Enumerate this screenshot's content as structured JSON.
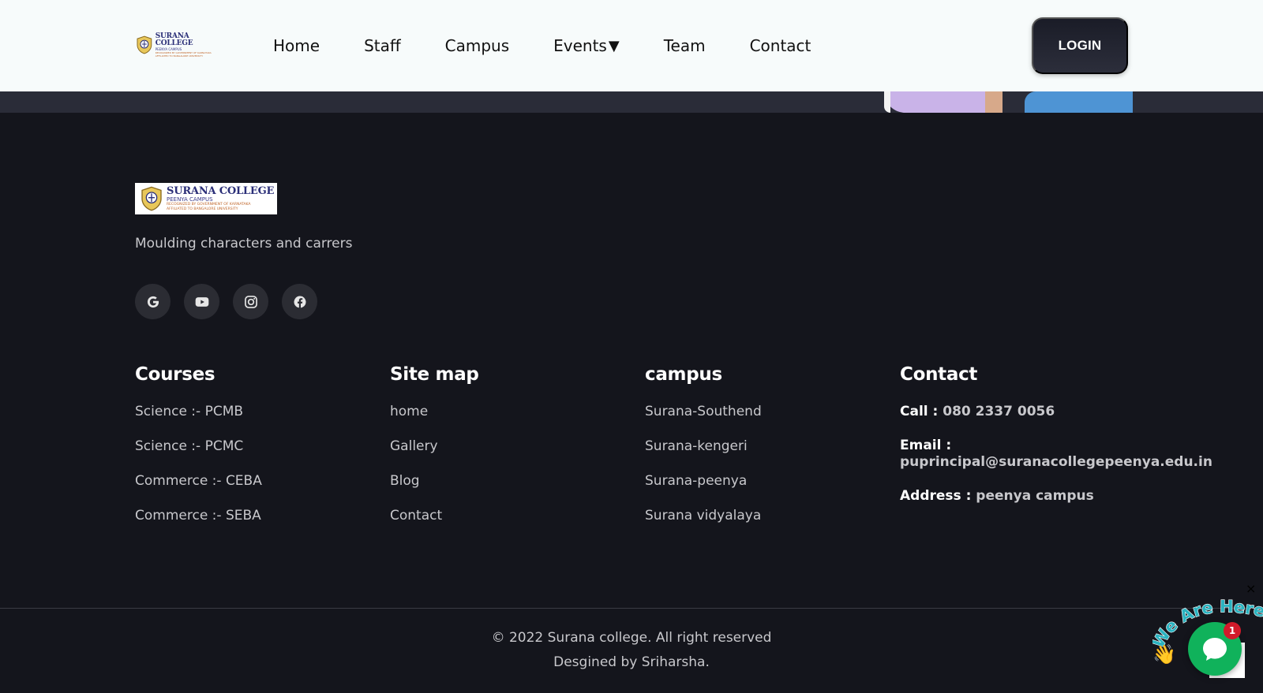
{
  "header": {
    "logo": {
      "title": "SURANA COLLEGE",
      "subtitle": "PEENYA CAMPUS",
      "line3": "RECOGNIZED BY GOVERNMENT OF KARNATAKA",
      "line4": "AFFILIATED TO BANGALORE UNIVERSITY"
    },
    "nav": [
      {
        "label": "Home"
      },
      {
        "label": "Staff"
      },
      {
        "label": "Campus"
      },
      {
        "label": "Events",
        "caret": "▼"
      },
      {
        "label": "Team"
      },
      {
        "label": "Contact"
      }
    ],
    "login_label": "LOGIN"
  },
  "footer": {
    "logo": {
      "title": "SURANA COLLEGE",
      "subtitle": "PEENYA CAMPUS",
      "line3": "RECOGNIZED BY GOVERNMENT OF KARNATAKA",
      "line4": "AFFILIATED TO BANGALORE UNIVERSITY"
    },
    "tagline": "Moulding characters and carrers",
    "socials": [
      "google-icon",
      "youtube-icon",
      "instagram-icon",
      "facebook-icon"
    ],
    "courses": {
      "heading": "Courses",
      "items": [
        "Science :- PCMB",
        "Science :- PCMC",
        "Commerce :- CEBA",
        "Commerce :- SEBA"
      ]
    },
    "sitemap": {
      "heading": "Site map",
      "items": [
        "home",
        "Gallery",
        "Blog",
        "Contact"
      ]
    },
    "campus": {
      "heading": "campus",
      "items": [
        "Surana-Southend",
        "Surana-kengeri",
        "Surana-peenya",
        "Surana vidyalaya"
      ]
    },
    "contact": {
      "heading": "Contact",
      "call_label": "Call :",
      "call_value": "080 2337 0056",
      "email_label": "Email :",
      "email_value": "puprincipal@suranacollegepeenya.edu.in",
      "address_label": "Address :",
      "address_value": "peenya campus"
    },
    "copyright": "© 2022 Surana college. All right reserved",
    "designed_by": "Desgined by Sriharsha."
  },
  "chat_widget": {
    "banner": "We Are Here!",
    "badge_count": "1",
    "close_symbol": "×",
    "hand": "👋",
    "colors": {
      "bubble": "#10b25b",
      "badge": "#d11a2a",
      "banner_text": "#2bb3c0"
    }
  }
}
